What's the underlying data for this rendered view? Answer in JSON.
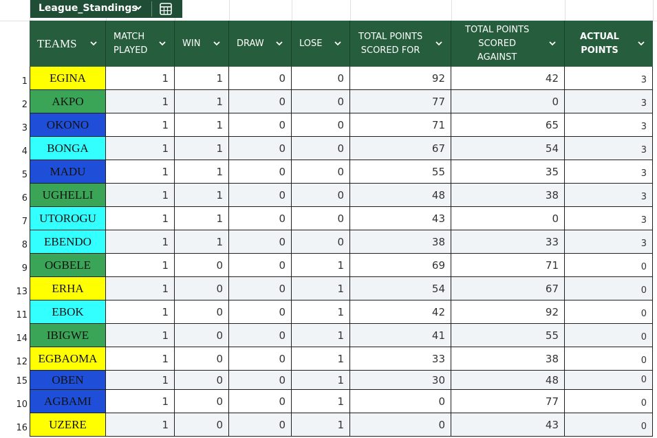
{
  "table_name": "League_Standings",
  "header": {
    "teams": "TEAMS",
    "match_played": "MATCH\nPLAYED",
    "win": "WIN",
    "draw": "DRAW",
    "lose": "LOSE",
    "points_for": "TOTAL POINTS\nSCORED FOR",
    "points_against": "TOTAL POINTS\nSCORED\nAGAINST",
    "actual_points": "ACTUAL\nPOINTS"
  },
  "colors": {
    "header_bg": "#255d3d",
    "chip_bg": "#1f4d35",
    "yellow": "#ffff00",
    "green": "#3aa556",
    "blue": "#1f4fd8",
    "cyan": "#33ffff",
    "row_alt": "#f1f4f7"
  },
  "rows": [
    {
      "num": "1",
      "team": "EGINA",
      "color": "yellow",
      "played": "1",
      "win": "1",
      "draw": "0",
      "lose": "0",
      "for": "92",
      "against": "42",
      "points": "3"
    },
    {
      "num": "2",
      "team": "AKPO",
      "color": "green",
      "played": "1",
      "win": "1",
      "draw": "0",
      "lose": "0",
      "for": "77",
      "against": "0",
      "points": "3"
    },
    {
      "num": "3",
      "team": "OKONO",
      "color": "blue",
      "played": "1",
      "win": "1",
      "draw": "0",
      "lose": "0",
      "for": "71",
      "against": "65",
      "points": "3"
    },
    {
      "num": "4",
      "team": "BONGA",
      "color": "cyan",
      "played": "1",
      "win": "1",
      "draw": "0",
      "lose": "0",
      "for": "67",
      "against": "54",
      "points": "3"
    },
    {
      "num": "5",
      "team": "MADU",
      "color": "blue",
      "played": "1",
      "win": "1",
      "draw": "0",
      "lose": "0",
      "for": "55",
      "against": "35",
      "points": "3"
    },
    {
      "num": "6",
      "team": "UGHELLI",
      "color": "green",
      "played": "1",
      "win": "1",
      "draw": "0",
      "lose": "0",
      "for": "48",
      "against": "38",
      "points": "3"
    },
    {
      "num": "7",
      "team": "UTOROGU",
      "color": "cyan",
      "played": "1",
      "win": "1",
      "draw": "0",
      "lose": "0",
      "for": "43",
      "against": "0",
      "points": "3"
    },
    {
      "num": "8",
      "team": "EBENDO",
      "color": "cyan",
      "played": "1",
      "win": "1",
      "draw": "0",
      "lose": "0",
      "for": "38",
      "against": "33",
      "points": "3"
    },
    {
      "num": "9",
      "team": "OGBELE",
      "color": "green",
      "played": "1",
      "win": "0",
      "draw": "0",
      "lose": "1",
      "for": "69",
      "against": "71",
      "points": "0"
    },
    {
      "num": "13",
      "team": "ERHA",
      "color": "yellow",
      "played": "1",
      "win": "0",
      "draw": "0",
      "lose": "1",
      "for": "54",
      "against": "67",
      "points": "0"
    },
    {
      "num": "11",
      "team": "EBOK",
      "color": "cyan",
      "played": "1",
      "win": "0",
      "draw": "0",
      "lose": "1",
      "for": "42",
      "against": "92",
      "points": "0"
    },
    {
      "num": "14",
      "team": "IBIGWE",
      "color": "green",
      "played": "1",
      "win": "0",
      "draw": "0",
      "lose": "1",
      "for": "41",
      "against": "55",
      "points": "0"
    },
    {
      "num": "12",
      "team": "EGBAOMA",
      "color": "yellow",
      "played": "1",
      "win": "0",
      "draw": "0",
      "lose": "1",
      "for": "33",
      "against": "38",
      "points": "0"
    },
    {
      "num": "15",
      "team": "OBEN",
      "color": "blue",
      "played": "1",
      "win": "0",
      "draw": "0",
      "lose": "1",
      "for": "30",
      "against": "48",
      "points": "0"
    },
    {
      "num": "10",
      "team": "AGBAMI",
      "color": "blue",
      "played": "1",
      "win": "0",
      "draw": "0",
      "lose": "1",
      "for": "0",
      "against": "77",
      "points": "0"
    },
    {
      "num": "16",
      "team": "UZERE",
      "color": "yellow",
      "played": "1",
      "win": "0",
      "draw": "0",
      "lose": "1",
      "for": "0",
      "against": "43",
      "points": "0"
    }
  ]
}
